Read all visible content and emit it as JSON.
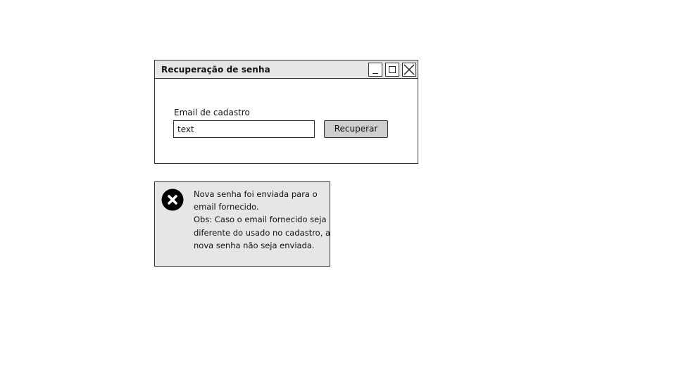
{
  "window": {
    "title": "Recuperação de senha",
    "controls": {
      "minimize": "minimize-icon",
      "maximize": "maximize-icon",
      "close": "close-icon"
    },
    "form": {
      "email_label": "Email de cadastro",
      "email_value": "text",
      "email_placeholder": "",
      "submit_label": "Recuperar"
    }
  },
  "alert": {
    "icon": "error-circle-x-icon",
    "lines": [
      "Nova senha foi enviada para o",
      "email fornecido.",
      "Obs: Caso o email fornecido seja",
      "diferente do usado no cadastro, a",
      "nova senha não seja enviada."
    ]
  },
  "colors": {
    "titlebar_bg": "#e6e6e6",
    "button_bg": "#cfcfcf",
    "alert_bg": "#e6e6e6",
    "border": "#333333",
    "icon_fill": "#000000"
  }
}
